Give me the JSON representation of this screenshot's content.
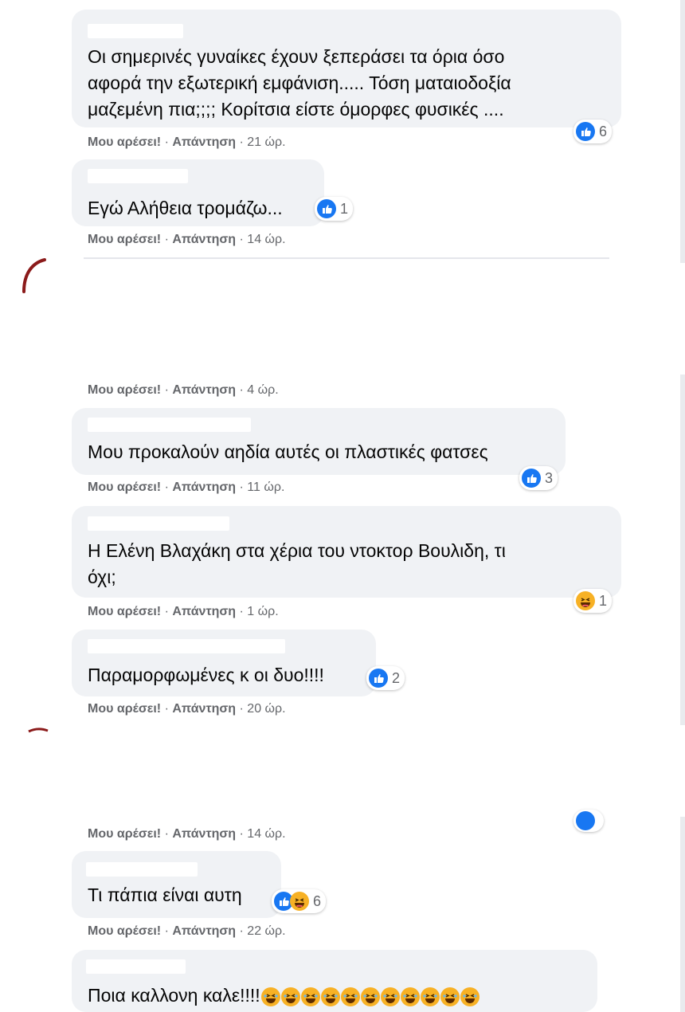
{
  "comments": [
    {
      "text_lines": [
        "Οι σημερινές γυναίκες έχουν ξεπεράσει τα όρια όσο",
        "αφορά την εξωτερική εμφάνιση..... Τόση ματαιοδοξία",
        "μαζεμένη πια;;;; Κορίτσια είστε όμορφες φυσικές ...."
      ],
      "reaction": {
        "type": "like",
        "count": "6"
      },
      "actions": {
        "like": "Μου αρέσει!",
        "reply": "Απάντηση",
        "time": "21 ώρ."
      }
    },
    {
      "text_lines": [
        "Εγώ Αλήθεια τρομάζω..."
      ],
      "reaction": {
        "type": "like",
        "count": "1"
      },
      "actions": {
        "like": "Μου αρέσει!",
        "reply": "Απάντηση",
        "time": "14 ώρ."
      }
    },
    {
      "text_lines": [],
      "actions": {
        "like": "Μου αρέσει!",
        "reply": "Απάντηση",
        "time": "4 ώρ."
      }
    },
    {
      "text_lines": [
        "Μου προκαλούν αηδία αυτές οι πλαστικές φατσες"
      ],
      "reaction": {
        "type": "like",
        "count": "3"
      },
      "actions": {
        "like": "Μου αρέσει!",
        "reply": "Απάντηση",
        "time": "11 ώρ."
      }
    },
    {
      "text_lines": [
        "Η Ελένη Βλαχάκη στα χέρια του ντοκτορ Βουλιδη, τι",
        "όχι;"
      ],
      "reaction": {
        "type": "haha",
        "count": "1"
      },
      "actions": {
        "like": "Μου αρέσει!",
        "reply": "Απάντηση",
        "time": "1 ώρ."
      }
    },
    {
      "text_lines": [
        "Παραμορφωμένες κ οι δυο!!!!"
      ],
      "reaction": {
        "type": "like",
        "count": "2"
      },
      "actions": {
        "like": "Μου αρέσει!",
        "reply": "Απάντηση",
        "time": "20 ώρ."
      }
    },
    {
      "text_lines": [],
      "actions": {
        "like": "Μου αρέσει!",
        "reply": "Απάντηση",
        "time": "14 ώρ."
      }
    },
    {
      "text_lines": [
        "Τι πάπια είναι αυτη"
      ],
      "reaction": {
        "type": "like+haha",
        "count": "6"
      },
      "actions": {
        "like": "Μου αρέσει!",
        "reply": "Απάντηση",
        "time": "22 ώρ."
      }
    },
    {
      "text_lines": [
        "Ποια καλλονη καλε!!!!"
      ],
      "emoji_trail": {
        "icon": "rofl-emoji",
        "count": 11
      }
    }
  ],
  "colors": {
    "bubble": "#f0f2f5",
    "like": "#1877f2",
    "haha": "#f7b125",
    "meta": "#65676b"
  }
}
